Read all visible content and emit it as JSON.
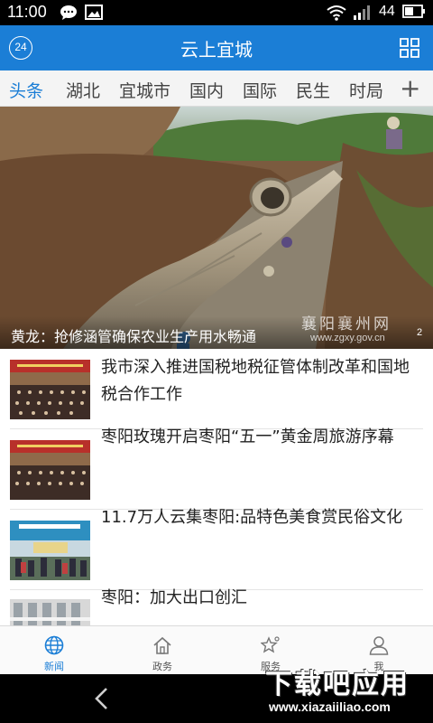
{
  "status_bar": {
    "time": "11:00",
    "battery": "44"
  },
  "header": {
    "title": "云上宜城",
    "weather_badge": "24"
  },
  "tabs": {
    "items": [
      "头条",
      "湖北",
      "宜城市",
      "国内",
      "国际",
      "民生",
      "时局"
    ],
    "active_index": 0,
    "add_symbol": "+"
  },
  "hero": {
    "caption": "黄龙：抢修涵管确保农业生产用水畅通",
    "watermark": "襄阳襄州网",
    "watermark_url": "www.zgxy.gov.cn",
    "page_indicator": "2"
  },
  "news": [
    {
      "headline": "我市深入推进国税地税征管体制改革和国地税合作工作",
      "thumb": "meeting"
    },
    {
      "headline": "枣阳玫瑰开启枣阳“五一”黄金周旅游序幕",
      "thumb": "meeting"
    },
    {
      "headline": "11.7万人云集枣阳:品特色美食赏民俗文化",
      "thumb": "crowd"
    },
    {
      "headline": "枣阳：加大出口创汇",
      "thumb": "factory"
    }
  ],
  "bottom_nav": [
    {
      "label": "新闻",
      "icon": "globe-icon",
      "active": true
    },
    {
      "label": "政务",
      "icon": "home-icon",
      "active": false
    },
    {
      "label": "服务",
      "icon": "star-icon",
      "active": false
    },
    {
      "label": "我",
      "icon": "person-icon",
      "active": false
    }
  ],
  "watermark": {
    "brand": "下载吧应用",
    "url": "www.xiazaiiliao.com"
  },
  "colors": {
    "accent": "#1b7ed6",
    "status_bar": "#000000",
    "tab_bar": "#f4f4f4"
  }
}
